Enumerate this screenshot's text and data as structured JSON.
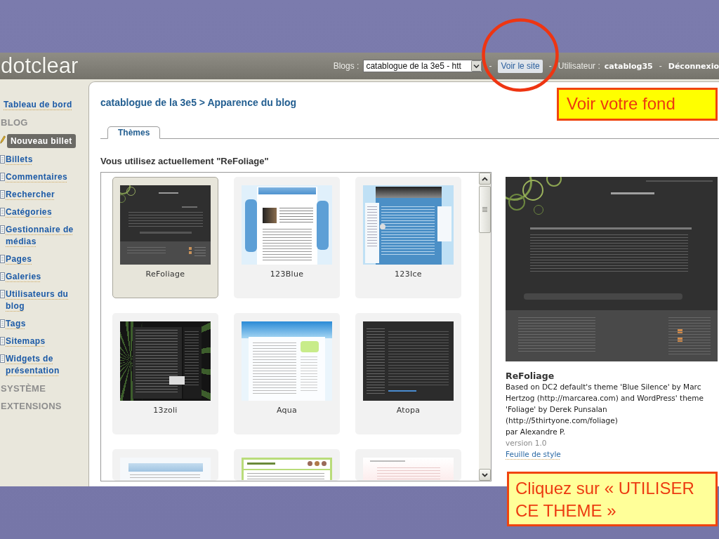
{
  "header": {
    "logo": "dotclear",
    "items": [
      {
        "kind": "label",
        "text": "Blogs :"
      },
      {
        "kind": "select",
        "value": "catablogue de la 3e5 - htt"
      },
      {
        "kind": "separator",
        "text": "-"
      },
      {
        "kind": "button",
        "text": "Voir le site"
      },
      {
        "kind": "separator",
        "text": "-"
      },
      {
        "kind": "label",
        "text": "Utilisateur :"
      },
      {
        "kind": "user",
        "text": "catablog35"
      },
      {
        "kind": "separator",
        "text": "-"
      },
      {
        "kind": "link",
        "text": "Déconnexio"
      }
    ]
  },
  "sidebar": {
    "dashboard": "Tableau de bord",
    "sections": [
      {
        "title": "BLOG",
        "items": [
          {
            "label": "Nouveau billet",
            "kind": "button"
          },
          {
            "label": "Billets",
            "kind": "link"
          },
          {
            "label": "Commentaires",
            "kind": "link"
          },
          {
            "label": "Rechercher",
            "kind": "link"
          },
          {
            "label": "Catégories",
            "kind": "link"
          },
          {
            "label": "Gestionnaire de médias",
            "kind": "link"
          },
          {
            "label": "Pages",
            "kind": "link"
          },
          {
            "label": "Galeries",
            "kind": "link"
          },
          {
            "label": "Utilisateurs du blog",
            "kind": "link"
          },
          {
            "label": "Tags",
            "kind": "link"
          },
          {
            "label": "Sitemaps",
            "kind": "link"
          },
          {
            "label": "Widgets de présentation",
            "kind": "link"
          }
        ]
      },
      {
        "title": "SYSTÈME"
      },
      {
        "title": "EXTENSIONS"
      }
    ]
  },
  "breadcrumb": "catablogue de la 3e5 > Apparence du blog",
  "tabs": [
    {
      "label": "Thèmes",
      "selected": true
    }
  ],
  "current_theme": "Vous utilisez actuellement \"ReFoliage\"",
  "themes": [
    {
      "name": "ReFoliage",
      "kind": "dark",
      "selected": true
    },
    {
      "name": "123Blue",
      "kind": "columns",
      "selected": false
    },
    {
      "name": "123Ice",
      "kind": "ice",
      "selected": false
    },
    {
      "name": "13zoli",
      "kind": "rays",
      "selected": false
    },
    {
      "name": "Aqua",
      "kind": "aqua",
      "selected": false
    },
    {
      "name": "Atopa",
      "kind": "slate",
      "selected": false
    },
    {
      "kind": "sky",
      "selected": false
    },
    {
      "kind": "lime",
      "selected": false
    },
    {
      "kind": "pink",
      "selected": false
    }
  ],
  "preview": {
    "title": "ReFoliage",
    "description": "Based on DC2 default's theme 'Blue Silence' by Marc Hertzog (http://marcarea.com) and WordPress' theme 'Foliage' by Derek Punsalan (http://5thirtyone.com/foliage)",
    "author": "par Alexandre P.",
    "version": "version 1.0",
    "stylesheet_link": "Feuille de style"
  },
  "callouts": [
    {
      "text": "Voir votre fond"
    },
    {
      "text": "Cliquez sur « UTILISER CE THEME »"
    }
  ]
}
